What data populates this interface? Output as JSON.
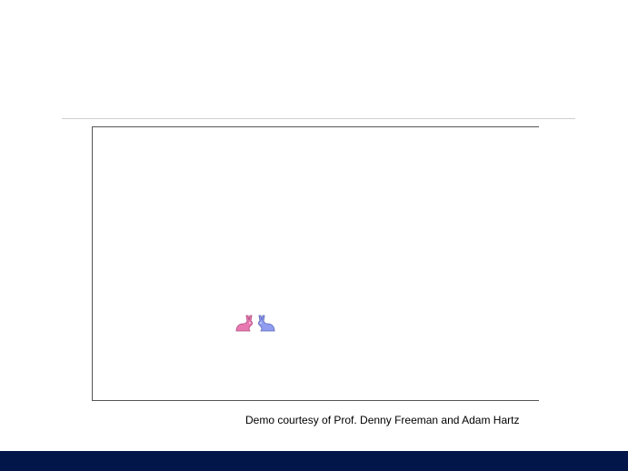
{
  "slide": {
    "credit_text": "Demo courtesy of Prof. Denny Freeman and Adam Hartz"
  },
  "demo": {
    "rabbits": [
      {
        "icon": "rabbit-icon",
        "color": "#e879b0"
      },
      {
        "icon": "rabbit-icon",
        "color": "#8f9cf0"
      }
    ]
  },
  "theme": {
    "footer_color": "#02164a",
    "rule_color": "#cfcfcf"
  }
}
